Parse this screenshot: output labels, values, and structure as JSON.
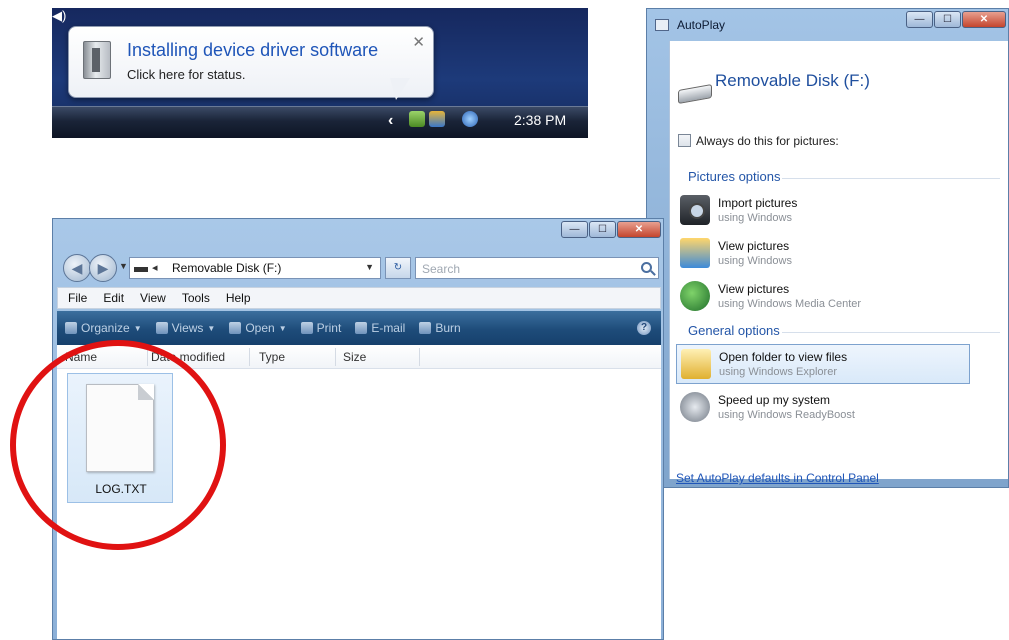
{
  "notification": {
    "title": "Installing device driver software",
    "subtitle": "Click here for status.",
    "close_glyph": "✕",
    "clock": "2:38 PM",
    "chevron": "‹"
  },
  "autoplay": {
    "window_title": "AutoPlay",
    "controls": {
      "minimize": "—",
      "maximize": "☐",
      "close": "✕"
    },
    "heading": "Removable Disk (F:)",
    "always_label": "Always do this for pictures:",
    "always_checked": false,
    "pictures_section": "Pictures options",
    "general_section": "General options",
    "options": [
      {
        "label": "Import pictures",
        "sub": "using Windows",
        "icon": "camera-icon"
      },
      {
        "label": "View pictures",
        "sub": "using Windows",
        "icon": "photo-viewer-icon"
      },
      {
        "label": "View pictures",
        "sub": "using Windows Media Center",
        "icon": "media-center-icon"
      },
      {
        "label": "Open folder to view files",
        "sub": "using Windows Explorer",
        "icon": "folder-icon",
        "selected": true
      },
      {
        "label": "Speed up my system",
        "sub": "using Windows ReadyBoost",
        "icon": "readyboost-icon"
      }
    ],
    "link": "Set AutoPlay defaults in Control Panel"
  },
  "explorer": {
    "controls": {
      "minimize": "—",
      "maximize": "☐",
      "close": "✕"
    },
    "address": "Removable Disk (F:)",
    "address_sep": "◂",
    "search_placeholder": "Search",
    "menu": [
      "File",
      "Edit",
      "View",
      "Tools",
      "Help"
    ],
    "toolbar": [
      "Organize",
      "Views",
      "Open",
      "Print",
      "E-mail",
      "Burn"
    ],
    "columns": [
      "Name",
      "Date modified",
      "Type",
      "Size"
    ],
    "file": {
      "name": "LOG.TXT",
      "icon": "text-file-icon"
    },
    "highlight_color": "#e01212"
  }
}
